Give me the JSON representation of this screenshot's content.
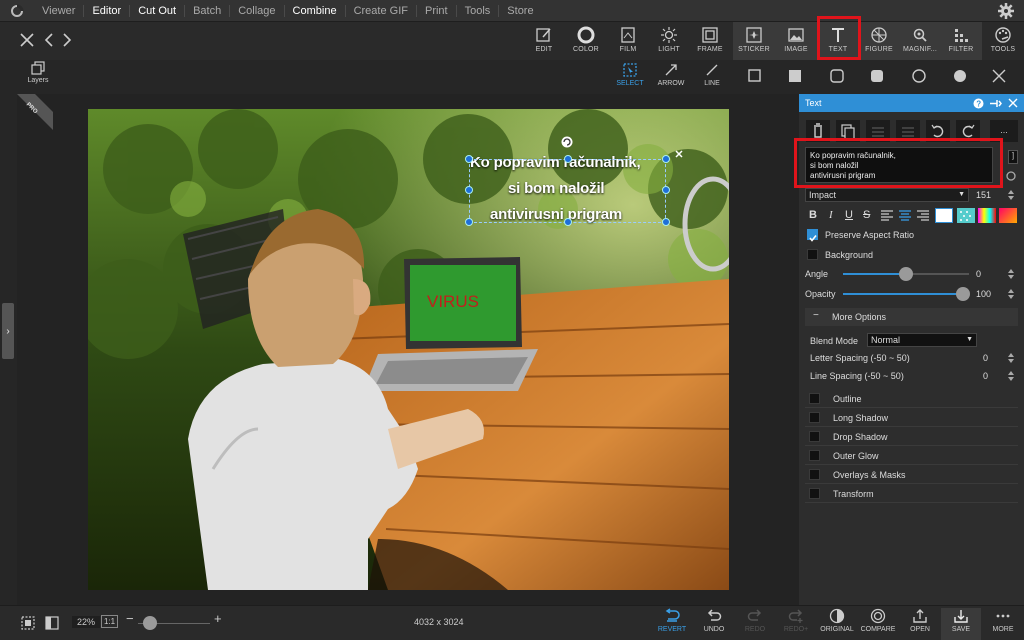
{
  "menu": {
    "items": [
      "Viewer",
      "Editor",
      "Cut Out",
      "Batch",
      "Collage",
      "Combine",
      "Create GIF",
      "Print",
      "Tools",
      "Store"
    ],
    "active": [
      "Editor",
      "Cut Out",
      "Combine"
    ]
  },
  "toolbar": {
    "tools": [
      {
        "label": "EDIT",
        "icon": "edit-icon"
      },
      {
        "label": "COLOR",
        "icon": "color-icon"
      },
      {
        "label": "FILM",
        "icon": "film-icon"
      },
      {
        "label": "LIGHT",
        "icon": "light-icon"
      },
      {
        "label": "FRAME",
        "icon": "frame-icon"
      },
      {
        "label": "STICKER",
        "icon": "sticker-icon"
      },
      {
        "label": "IMAGE",
        "icon": "image-icon"
      },
      {
        "label": "TEXT",
        "icon": "text-icon"
      },
      {
        "label": "FIGURE",
        "icon": "figure-icon"
      },
      {
        "label": "MAGNIF...",
        "icon": "magnifier-icon"
      },
      {
        "label": "FILTER",
        "icon": "filter-icon"
      },
      {
        "label": "TOOLS",
        "icon": "tools-icon"
      }
    ]
  },
  "subbar": {
    "tools": [
      {
        "label": "SELECT",
        "icon": "select-icon",
        "selected": true
      },
      {
        "label": "ARROW",
        "icon": "arrow-icon"
      },
      {
        "label": "LINE",
        "icon": "line-icon"
      }
    ]
  },
  "layers": {
    "label": "Layers"
  },
  "pro_badge": "PRO",
  "photo": {
    "text_lines": [
      "Ko popravim računalnik,",
      "si bom naložil",
      "antivirusni prigram"
    ],
    "laptop_text": "VIRUS"
  },
  "panel": {
    "title": "Text",
    "text_value": "Ko popravim računalnik,\nsi bom naložil\nantivirusni prigram",
    "font": "Impact",
    "font_size": "151",
    "preserve_aspect_ratio": "Preserve Aspect Ratio",
    "background": "Background",
    "angle_label": "Angle",
    "angle_value": "0",
    "opacity_label": "Opacity",
    "opacity_value": "100",
    "more_options": "More Options",
    "blend_mode_label": "Blend Mode",
    "blend_mode_value": "Normal",
    "letter_spacing_label": "Letter Spacing (-50 ~ 50)",
    "letter_spacing_value": "0",
    "line_spacing_label": "Line Spacing (-50 ~ 50)",
    "line_spacing_value": "0",
    "options": [
      "Outline",
      "Long Shadow",
      "Drop Shadow",
      "Outer Glow",
      "Overlays & Masks",
      "Transform"
    ]
  },
  "bottom": {
    "zoom": "22%",
    "one_to_one": "1:1",
    "dimensions": "4032 x 3024",
    "buttons": [
      {
        "label": "REVERT",
        "icon": "revert-icon"
      },
      {
        "label": "UNDO",
        "icon": "undo-icon"
      },
      {
        "label": "REDO",
        "icon": "redo-icon"
      },
      {
        "label": "REDO+",
        "icon": "redo-plus-icon"
      },
      {
        "label": "ORIGINAL",
        "icon": "original-icon"
      },
      {
        "label": "COMPARE",
        "icon": "compare-icon"
      },
      {
        "label": "OPEN",
        "icon": "open-icon"
      },
      {
        "label": "SAVE",
        "icon": "save-icon"
      },
      {
        "label": "MORE",
        "icon": "more-icon"
      }
    ]
  },
  "colors": {
    "accent": "#2f8fd6",
    "highlight": "#e0141b",
    "laptop_screen": "#2f9a2f",
    "virus_text": "#c0201d"
  }
}
